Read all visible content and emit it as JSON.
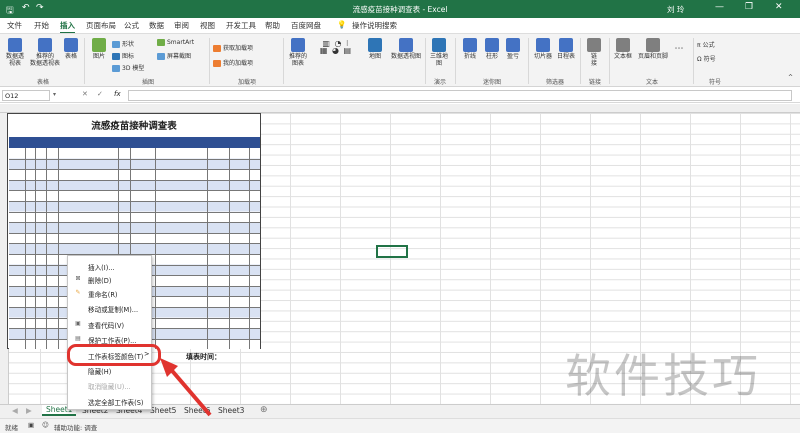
{
  "window": {
    "title": "流感疫苗接种调查表 - Excel",
    "user": "刘 玲",
    "min": "—",
    "restore": "❐",
    "close": "✕",
    "qa_save": "🖫",
    "qa_undo": "↶",
    "qa_redo": "↷"
  },
  "menu": {
    "tabs": [
      "文件",
      "开始",
      "插入",
      "页面布局",
      "公式",
      "数据",
      "审阅",
      "视图",
      "开发工具",
      "帮助",
      "百度网盘"
    ],
    "active_index": 2,
    "tell_me": "操作说明搜索"
  },
  "ribbon": {
    "buttons": [
      {
        "label": "数据透\n视表",
        "color": "#4472c4"
      },
      {
        "label": "推荐的\n数据透视表",
        "color": "#4472c4"
      },
      {
        "label": "表格",
        "color": "#4472c4"
      },
      {
        "label": "图片",
        "color": "#70ad47"
      },
      {
        "label": "推荐的\n图表",
        "color": "#4472c4"
      },
      {
        "label": "地图",
        "color": "#2e75b6"
      },
      {
        "label": "数据透视图",
        "color": "#4472c4"
      },
      {
        "label": "三维地\n图",
        "color": "#2e75b6"
      },
      {
        "label": "折线",
        "color": "#4472c4"
      },
      {
        "label": "柱形",
        "color": "#4472c4"
      },
      {
        "label": "盈亏",
        "color": "#4472c4"
      },
      {
        "label": "切片器",
        "color": "#4472c4"
      },
      {
        "label": "日程表",
        "color": "#4472c4"
      },
      {
        "label": "链\n接",
        "color": "#7f7f7f"
      },
      {
        "label": "文本框",
        "color": "#7f7f7f"
      },
      {
        "label": "页眉和页脚",
        "color": "#7f7f7f"
      }
    ],
    "small": [
      {
        "label": "形状",
        "color": "#5b9bd5"
      },
      {
        "label": "图标",
        "color": "#2e75b6"
      },
      {
        "label": "3D 模型",
        "color": "#5b9bd5"
      },
      {
        "label": "SmartArt",
        "color": "#70ad47"
      },
      {
        "label": "屏幕截图",
        "color": "#5b9bd5"
      },
      {
        "label": "获取加载项",
        "color": "#ed7d31"
      },
      {
        "label": "我的加载项",
        "color": "#ed7d31"
      },
      {
        "label": "公式",
        "color": "#333333"
      },
      {
        "label": "符号",
        "color": "#333333"
      }
    ],
    "groups": [
      "表格",
      "插图",
      "加载项",
      "演示",
      "迷你图",
      "筛选器",
      "链接",
      "文本",
      "符号"
    ]
  },
  "formula": {
    "namebox": "O12",
    "fx": "fx"
  },
  "sheet": {
    "form_title": "流感疫苗接种调查表",
    "fill_time": "填表时间："
  },
  "context_menu": [
    {
      "label": "插入(I)...",
      "icon": "",
      "disabled": false
    },
    {
      "label": "删除(D)",
      "icon": "⊠",
      "disabled": false
    },
    {
      "label": "重命名(R)",
      "icon": "✎",
      "disabled": false
    },
    {
      "label": "移动或复制(M)...",
      "icon": "",
      "disabled": false
    },
    {
      "label": "查看代码(V)",
      "icon": "▣",
      "disabled": false
    },
    {
      "label": "保护工作表(P)...",
      "icon": "▤",
      "disabled": false
    },
    {
      "label": "工作表标签颜色(T)",
      "icon": "",
      "disabled": false,
      "arrow": ">"
    },
    {
      "label": "隐藏(H)",
      "icon": "",
      "disabled": false
    },
    {
      "label": "取消隐藏(U)...",
      "icon": "",
      "disabled": true
    },
    {
      "label": "选定全部工作表(S)",
      "icon": "",
      "disabled": false
    }
  ],
  "sheets": {
    "tabs": [
      "Sheet1",
      "Sheet2",
      "Sheet4",
      "Sheet5",
      "Sheet6",
      "Sheet3"
    ],
    "active": "Sheet1",
    "add": "⊕",
    "nav_prev": "◀",
    "nav_next": "▶"
  },
  "status": {
    "ready": "就绪",
    "accessibility": "辅助功能: 调查"
  },
  "watermark": "软件技巧",
  "colors": {
    "accent": "#217346",
    "highlight": "#e0332e",
    "header_fill": "#2e4f93",
    "band_fill": "#d9e2f3"
  }
}
